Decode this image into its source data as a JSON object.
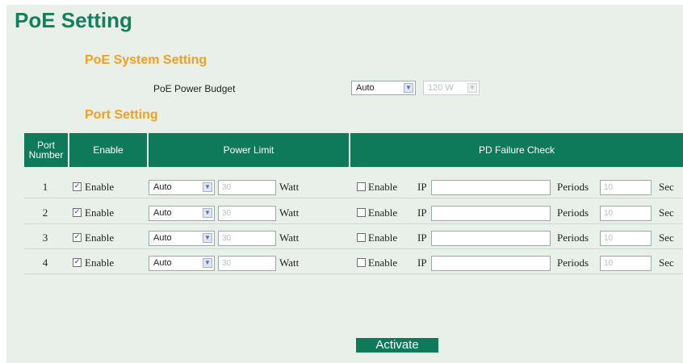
{
  "page": {
    "title": "PoE Setting",
    "system_section": "PoE System Setting",
    "budget_label": "PoE Power Budget",
    "budget_mode": "Auto",
    "budget_value": "120 W",
    "port_section": "Port Setting",
    "activate_label": "Activate"
  },
  "table": {
    "headers": {
      "port_number": "Port Number",
      "enable": "Enable",
      "power_limit": "Power Limit",
      "pd_failure_check": "PD Failure Check"
    },
    "labels": {
      "enable": "Enable",
      "watt": "Watt",
      "ip": "IP",
      "periods": "Periods",
      "sec": "Sec"
    },
    "rows": [
      {
        "port": "1",
        "enable_checked": true,
        "limit_mode": "Auto",
        "limit_watt": "30",
        "pd_enable_checked": false,
        "ip": "",
        "periods": "10"
      },
      {
        "port": "2",
        "enable_checked": true,
        "limit_mode": "Auto",
        "limit_watt": "30",
        "pd_enable_checked": false,
        "ip": "",
        "periods": "10"
      },
      {
        "port": "3",
        "enable_checked": true,
        "limit_mode": "Auto",
        "limit_watt": "30",
        "pd_enable_checked": false,
        "ip": "",
        "periods": "10"
      },
      {
        "port": "4",
        "enable_checked": true,
        "limit_mode": "Auto",
        "limit_watt": "30",
        "pd_enable_checked": false,
        "ip": "",
        "periods": "10"
      }
    ]
  }
}
